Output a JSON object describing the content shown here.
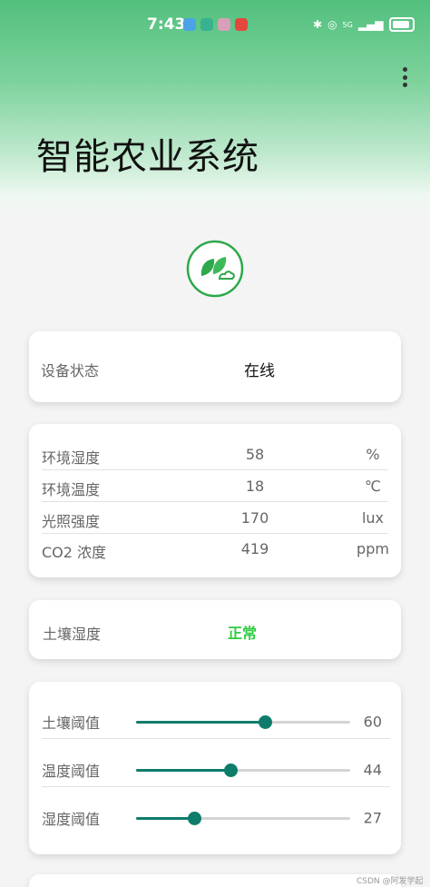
{
  "status_bar": {
    "time": "7:43",
    "icons": [
      "cloud-icon",
      "shield-icon",
      "app-icon",
      "notification-icon",
      "bluetooth-icon",
      "hotspot-icon",
      "signal-icon",
      "battery-icon"
    ],
    "network": "5G"
  },
  "header": {
    "title": "智能农业系统",
    "menu_icon": "more-vertical-icon"
  },
  "logo": {
    "icon": "leaf-cloud-icon",
    "color": "#2ea84a"
  },
  "device_status": {
    "label": "设备状态",
    "value": "在线"
  },
  "environment": [
    {
      "name": "环境湿度",
      "value": "58",
      "unit": "%"
    },
    {
      "name": "环境温度",
      "value": "18",
      "unit": "℃"
    },
    {
      "name": "光照强度",
      "value": "170",
      "unit": "lux"
    },
    {
      "name": "CO2 浓度",
      "value": "419",
      "unit": "ppm"
    }
  ],
  "soil": {
    "label": "土壤湿度",
    "value": "正常",
    "value_color": "#2ecc40"
  },
  "thresholds": [
    {
      "name": "土壤阈值",
      "value": "60",
      "fraction": 0.6
    },
    {
      "name": "温度阈值",
      "value": "44",
      "fraction": 0.44
    },
    {
      "name": "湿度阈值",
      "value": "27",
      "fraction": 0.27
    }
  ],
  "slider_color": "#0e7c6b",
  "watermark": "CSDN @阿发学起来"
}
